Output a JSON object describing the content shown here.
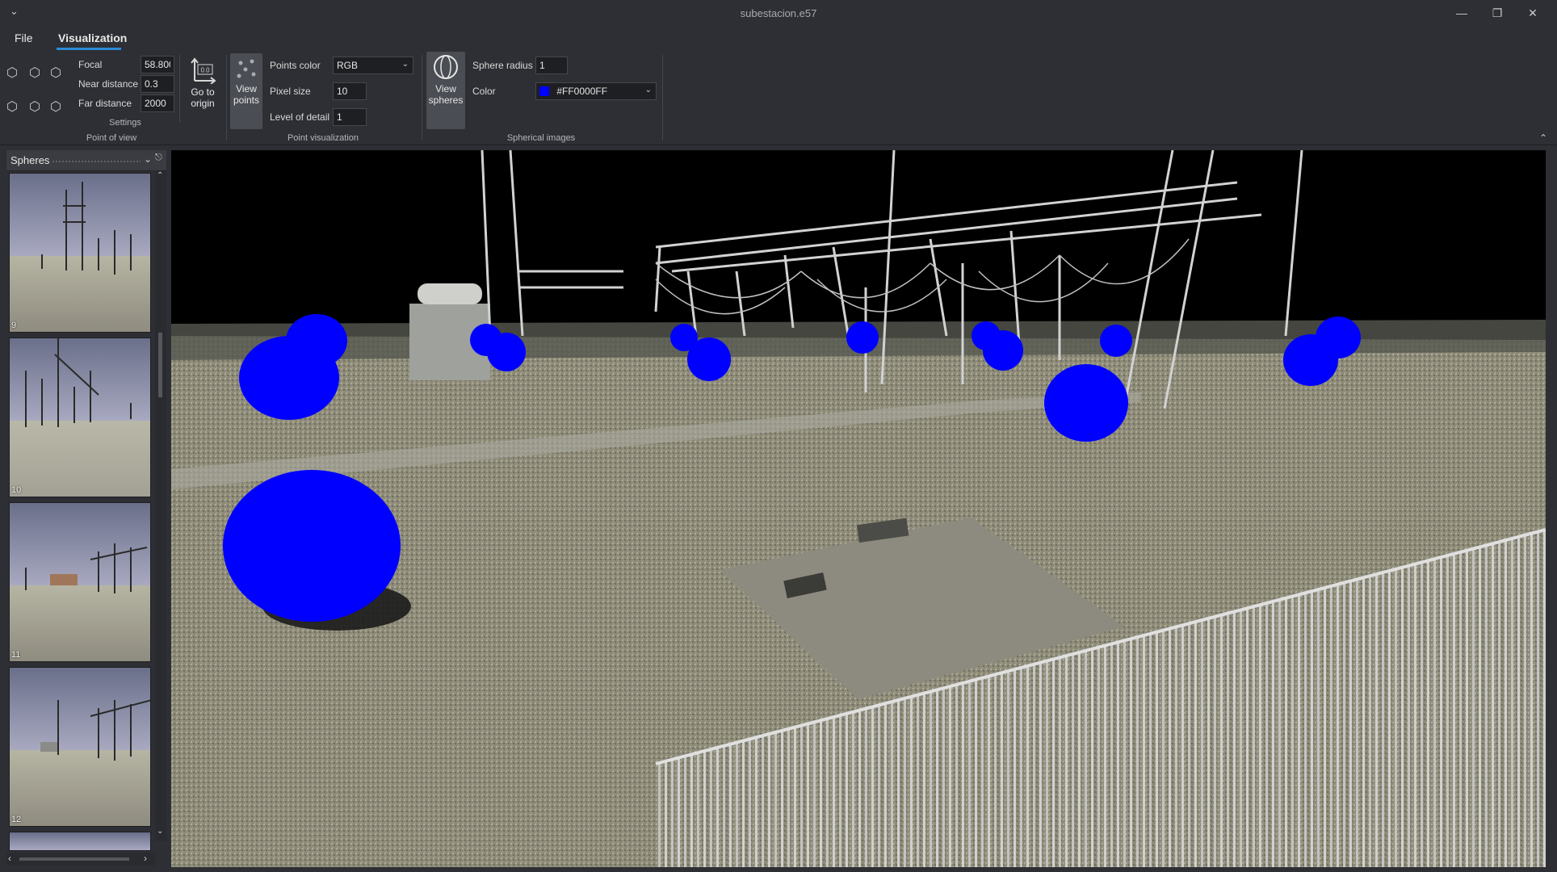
{
  "window": {
    "title": "subestacion.e57"
  },
  "menu": {
    "file": "File",
    "visualization": "Visualization"
  },
  "ribbon": {
    "pov": {
      "focal_label": "Focal",
      "focal_value": "58.800",
      "near_label": "Near distance",
      "near_value": "0.3",
      "far_label": "Far distance",
      "far_value": "2000",
      "settings_caption": "Settings",
      "group_caption": "Point of view",
      "origin_line1": "Go to",
      "origin_line2": "origin",
      "origin_icon_text": "0.0"
    },
    "points": {
      "view_line1": "View",
      "view_line2": "points",
      "color_label": "Points color",
      "color_value": "RGB",
      "pixel_label": "Pixel size",
      "pixel_value": "10",
      "lod_label": "Level of detail",
      "lod_value": "1",
      "group_caption": "Point visualization"
    },
    "spheres": {
      "view_line1": "View",
      "view_line2": "spheres",
      "radius_label": "Sphere radius",
      "radius_value": "1",
      "color_label": "Color",
      "color_value": "#FF0000FF",
      "swatch": "#0000ff",
      "group_caption": "Spherical images"
    }
  },
  "panel": {
    "title": "Spheres",
    "thumbnails": [
      {
        "label": "9"
      },
      {
        "label": "10"
      },
      {
        "label": "11"
      },
      {
        "label": "12"
      }
    ]
  },
  "colors": {
    "accent": "#2d8ad6",
    "sphere": "#0000ff",
    "background": "#2d2f34"
  }
}
